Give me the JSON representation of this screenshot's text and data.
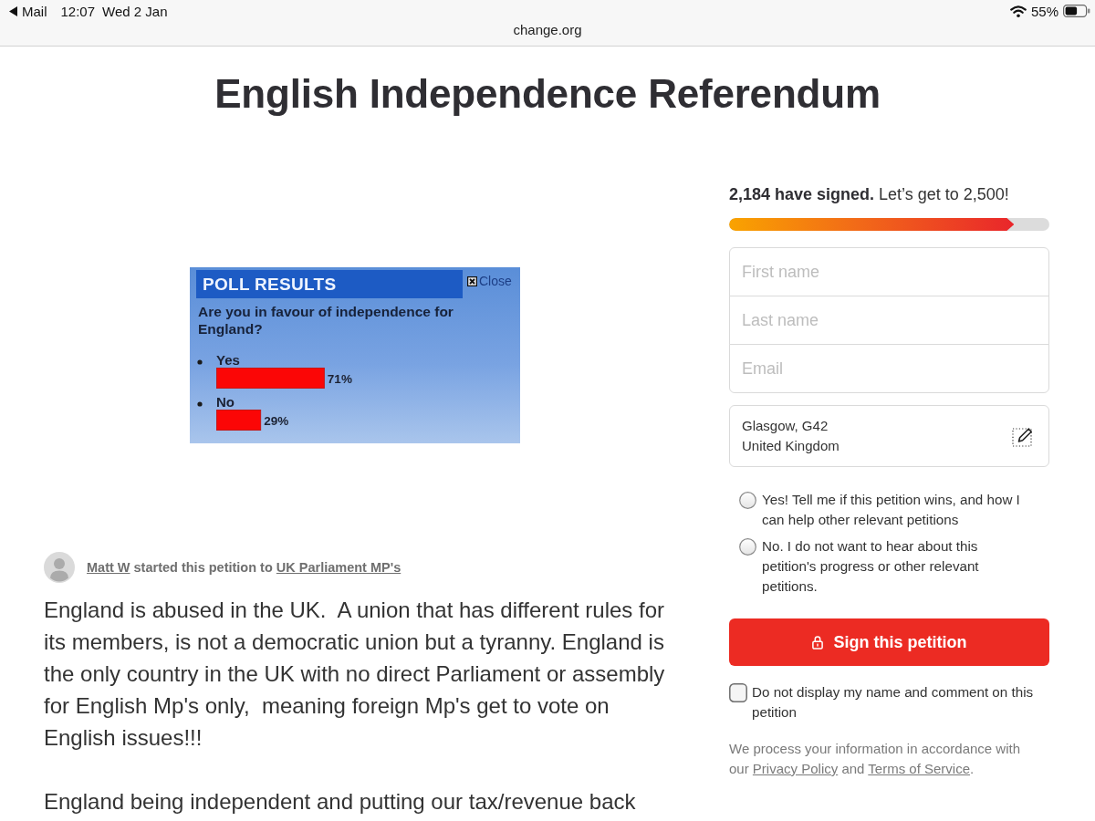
{
  "status_bar": {
    "back_label": "Mail",
    "time": "12:07",
    "date": "Wed 2 Jan",
    "battery": "55%",
    "url": "change.org"
  },
  "title": "English Independence Referendum",
  "poll": {
    "header": "POLL RESULTS",
    "close": "Close",
    "question": "Are you in favour of independence for England?",
    "chart_data": {
      "type": "bar",
      "orientation": "horizontal",
      "categories": [
        "Yes",
        "No"
      ],
      "values": [
        71,
        29
      ],
      "value_labels": [
        "71%",
        "29%"
      ]
    }
  },
  "author_line": [
    {
      "kind": "link",
      "text": "Matt W"
    },
    {
      "kind": "text",
      "text": " started this petition to "
    },
    {
      "kind": "link",
      "text": "UK Parliament MP's"
    }
  ],
  "body": [
    "England is abused in the UK.  A union that has different rules for its members, is not a democratic union but a tyranny. England is the only country in the UK with no direct Parliament or assembly for English Mp's only,  meaning foreign Mp's get to vote on English issues!!!",
    "England being independent and putting our tax/revenue back"
  ],
  "sign_panel": {
    "progress_text": "**2,184 have signed.** Let’s get to 2,500!",
    "progress": {
      "level": 0.89
    },
    "fields": [
      {
        "placeholder": "First name"
      },
      {
        "placeholder": "Last name"
      },
      {
        "placeholder": "Email"
      }
    ],
    "location": [
      "Glasgow, G42",
      "United Kingdom"
    ],
    "subscription_options": [
      {
        "label": "Yes! Tell me if this petition wins, and how I can help other relevant petitions",
        "selected": false
      },
      {
        "label": "No. I do not want to hear about this petition's progress or other relevant petitions.",
        "selected": false
      }
    ],
    "sign_button": "Sign this petition",
    "hide_name": {
      "label": "Do not display my name and comment on this petition",
      "checked": false
    },
    "privacy_notice": [
      {
        "kind": "text",
        "text": "We process your information in accordance with our "
      },
      {
        "kind": "link",
        "text": "Privacy Policy"
      },
      {
        "kind": "text",
        "text": " and "
      },
      {
        "kind": "link",
        "text": "Terms of Service"
      },
      {
        "kind": "text",
        "text": "."
      }
    ]
  }
}
